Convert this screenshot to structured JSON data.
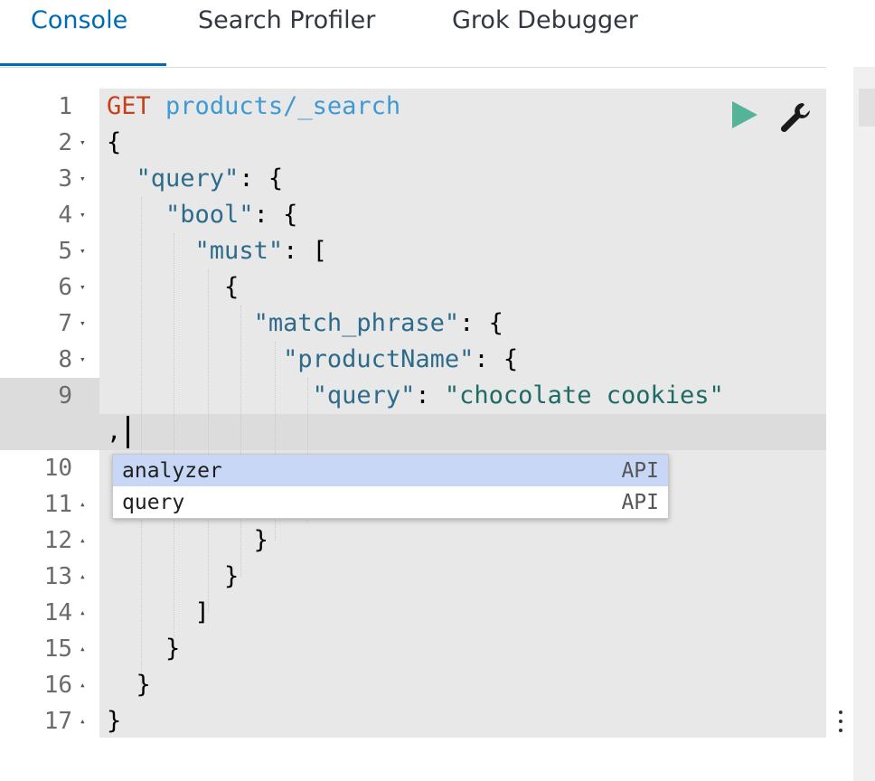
{
  "tabs": [
    {
      "label": "Console",
      "active": true
    },
    {
      "label": "Search Profiler",
      "active": false
    },
    {
      "label": "Grok Debugger",
      "active": false
    }
  ],
  "editor": {
    "gutter": {
      "line_numbers": [
        "1",
        "2",
        "3",
        "4",
        "5",
        "6",
        "7",
        "8",
        "9",
        "10",
        "11",
        "12",
        "13",
        "14",
        "15",
        "16",
        "17"
      ],
      "fold_markers": [
        "",
        "▾",
        "▾",
        "▾",
        "▾",
        "▾",
        "▾",
        "▾",
        "",
        "",
        "▴",
        "▴",
        "▴",
        "▴",
        "▴",
        "▴",
        "▴"
      ]
    },
    "lines": {
      "l1_method": "GET",
      "l1_url": "products/_search",
      "l2": "{",
      "l3_key": "\"query\"",
      "l3_rest": ": {",
      "l4_key": "\"bool\"",
      "l4_rest": ": {",
      "l5_key": "\"must\"",
      "l5_rest": ": [",
      "l6": "{",
      "l7_key": "\"match_phrase\"",
      "l7_rest": ": {",
      "l8_key": "\"productName\"",
      "l8_rest": ": {",
      "l9_key": "\"query\"",
      "l9_colon": ": ",
      "l9_value": "\"chocolate cookies\"",
      "l9_wrap": ",",
      "l12": "}",
      "l13": "}",
      "l14": "]",
      "l15": "}",
      "l16": "}",
      "l17": "}"
    },
    "run_icon": "play-icon",
    "settings_icon": "wrench-icon",
    "colors": {
      "method": "#c7401c",
      "url": "#3f9ad4",
      "key": "#2d6b8a",
      "string": "#1e6a64",
      "run": "#54b399",
      "active_tab": "#006bb4"
    }
  },
  "autocomplete": {
    "items": [
      {
        "label": "analyzer",
        "meta": "API",
        "selected": true
      },
      {
        "label": "query",
        "meta": "API",
        "selected": false
      }
    ]
  },
  "overflow_icon": "vertical-dots-icon"
}
